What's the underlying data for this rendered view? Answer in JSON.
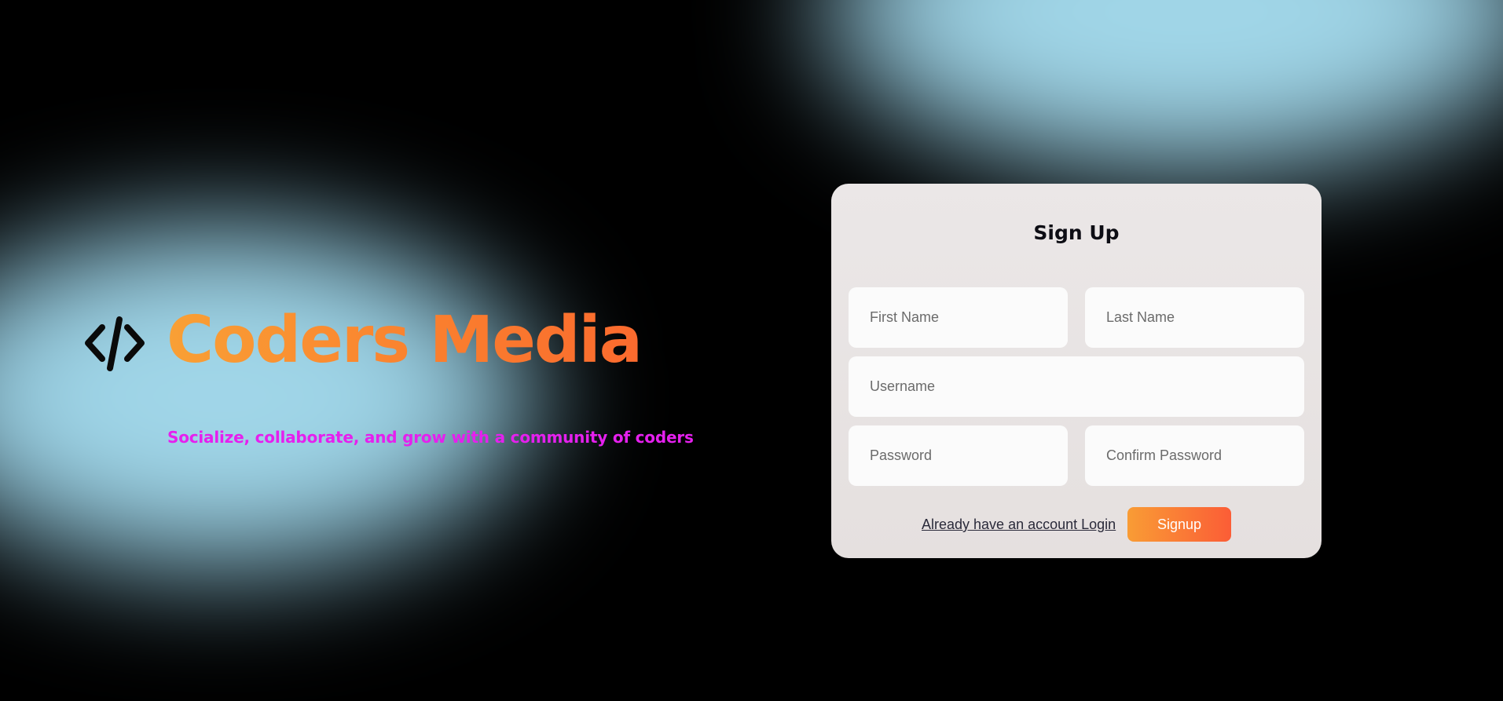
{
  "brand": {
    "icon": "code-brackets-icon",
    "title": "Coders Media",
    "tagline": "Socialize, collaborate, and grow with a community of coders"
  },
  "signup_form": {
    "title": "Sign Up",
    "first_name_placeholder": "First Name",
    "last_name_placeholder": "Last Name",
    "username_placeholder": "Username",
    "password_placeholder": "Password",
    "confirm_password_placeholder": "Confirm Password",
    "login_link_text": "Already have an account Login",
    "submit_label": "Signup"
  },
  "colors": {
    "background": "#000000",
    "glow": "#a3d8ea",
    "brand_gradient_start": "#f9a035",
    "brand_gradient_end": "#fb6a2e",
    "tagline": "#e520ee",
    "card": "#e8e4e3",
    "button_gradient_start": "#f99c35",
    "button_gradient_end": "#fb5d36"
  }
}
